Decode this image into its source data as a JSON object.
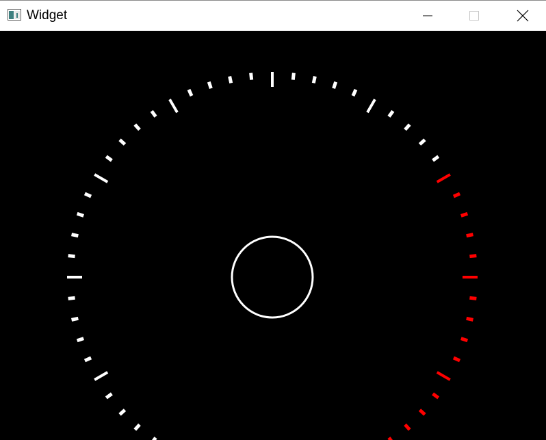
{
  "window": {
    "title": "Widget",
    "app_icon": "qt-app-window-icon",
    "controls": {
      "minimize_icon": "minimize-icon",
      "maximize_icon": "maximize-icon",
      "close_icon": "close-icon"
    }
  },
  "gauge": {
    "tick_count": 51,
    "major_every": 5,
    "red_from_tick": 35,
    "colors": {
      "tick_normal": "#ffffff",
      "tick_warning": "#ff0000",
      "background": "#000000",
      "center_ring": "#ffffff"
    }
  }
}
